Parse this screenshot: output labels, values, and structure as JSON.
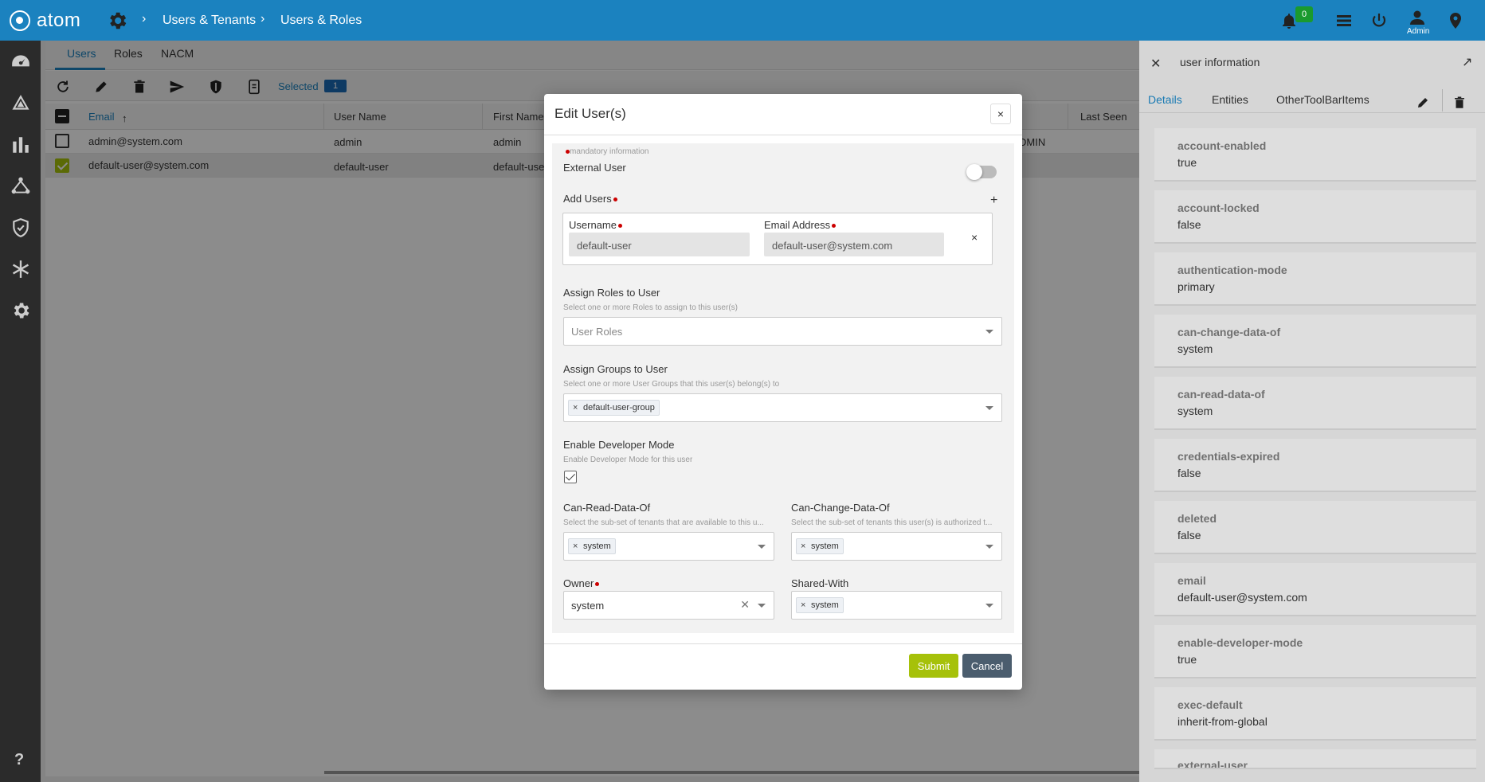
{
  "app": {
    "logo_text": "atom"
  },
  "breadcrumb": [
    "Users & Tenants",
    "Users & Roles"
  ],
  "topbar": {
    "notification_count": "0",
    "user_label": "Admin"
  },
  "tabs": [
    {
      "label": "Users",
      "active": true
    },
    {
      "label": "Roles",
      "active": false
    },
    {
      "label": "NACM",
      "active": false
    }
  ],
  "toolbar": {
    "selected_label": "Selected",
    "selected_count": "1"
  },
  "grid": {
    "columns": [
      "Email",
      "User Name",
      "First Name",
      "Last Seen"
    ],
    "rows": [
      {
        "email": "admin@system.com",
        "username": "admin",
        "first_name": "admin",
        "role_fragment": "DMIN",
        "checked": false
      },
      {
        "email": "default-user@system.com",
        "username": "default-user",
        "first_name": "default-use",
        "role_fragment": "",
        "checked": true
      }
    ]
  },
  "modal": {
    "title": "Edit User(s)",
    "close": "×",
    "mandatory_note": "mandatory information",
    "external_user_label": "External User",
    "external_user_enabled": false,
    "add_users_label": "Add Users",
    "add_users_plus": "+",
    "username_label": "Username",
    "username_value": "default-user",
    "email_label": "Email Address",
    "email_value": "default-user@system.com",
    "remove_row": "×",
    "roles_label": "Assign Roles to User",
    "roles_hint": "Select one or more Roles to assign to this user(s)",
    "roles_placeholder": "User Roles",
    "groups_label": "Assign Groups to User",
    "groups_hint": "Select one or more User Groups that this user(s) belong(s) to",
    "groups_chip": "default-user-group",
    "dev_label": "Enable Developer Mode",
    "dev_hint": "Enable Developer Mode for this user",
    "dev_enabled": true,
    "can_read_label": "Can-Read-Data-Of",
    "can_read_hint": "Select the sub-set of tenants that are available to this u...",
    "can_read_chip": "system",
    "can_change_label": "Can-Change-Data-Of",
    "can_change_hint": "Select the sub-set of tenants this user(s) is authorized t...",
    "can_change_chip": "system",
    "owner_label": "Owner",
    "owner_value": "system",
    "shared_label": "Shared-With",
    "shared_chip": "system",
    "chip_x": "×",
    "submit": "Submit",
    "cancel": "Cancel"
  },
  "right_panel": {
    "title": "user information",
    "tabs": [
      "Details",
      "Entities",
      "OtherToolBarItems"
    ],
    "fields": [
      {
        "key": "account-enabled",
        "value": "true"
      },
      {
        "key": "account-locked",
        "value": "false"
      },
      {
        "key": "authentication-mode",
        "value": "primary"
      },
      {
        "key": "can-change-data-of",
        "value": "system"
      },
      {
        "key": "can-read-data-of",
        "value": "system"
      },
      {
        "key": "credentials-expired",
        "value": "false"
      },
      {
        "key": "deleted",
        "value": "false"
      },
      {
        "key": "email",
        "value": "default-user@system.com"
      },
      {
        "key": "enable-developer-mode",
        "value": "true"
      },
      {
        "key": "exec-default",
        "value": "inherit-from-global"
      },
      {
        "key": "external-user",
        "value": ""
      }
    ]
  },
  "colors": {
    "topbar": "#1b82bf",
    "leftnav": "#2b2b2b",
    "submit": "#a6c10a",
    "cancel": "#4b5d6e",
    "badge": "#1a9a2e"
  }
}
